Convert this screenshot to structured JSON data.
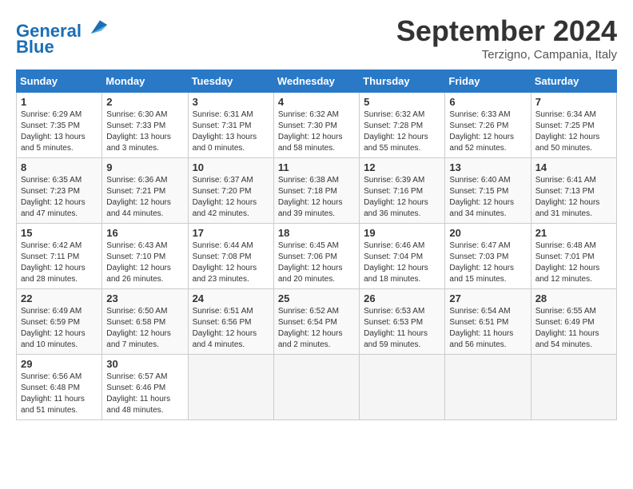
{
  "header": {
    "logo_line1": "General",
    "logo_line2": "Blue",
    "month_year": "September 2024",
    "location": "Terzigno, Campania, Italy"
  },
  "weekdays": [
    "Sunday",
    "Monday",
    "Tuesday",
    "Wednesday",
    "Thursday",
    "Friday",
    "Saturday"
  ],
  "weeks": [
    [
      {
        "day": "1",
        "info": "Sunrise: 6:29 AM\nSunset: 7:35 PM\nDaylight: 13 hours\nand 5 minutes."
      },
      {
        "day": "2",
        "info": "Sunrise: 6:30 AM\nSunset: 7:33 PM\nDaylight: 13 hours\nand 3 minutes."
      },
      {
        "day": "3",
        "info": "Sunrise: 6:31 AM\nSunset: 7:31 PM\nDaylight: 13 hours\nand 0 minutes."
      },
      {
        "day": "4",
        "info": "Sunrise: 6:32 AM\nSunset: 7:30 PM\nDaylight: 12 hours\nand 58 minutes."
      },
      {
        "day": "5",
        "info": "Sunrise: 6:32 AM\nSunset: 7:28 PM\nDaylight: 12 hours\nand 55 minutes."
      },
      {
        "day": "6",
        "info": "Sunrise: 6:33 AM\nSunset: 7:26 PM\nDaylight: 12 hours\nand 52 minutes."
      },
      {
        "day": "7",
        "info": "Sunrise: 6:34 AM\nSunset: 7:25 PM\nDaylight: 12 hours\nand 50 minutes."
      }
    ],
    [
      {
        "day": "8",
        "info": "Sunrise: 6:35 AM\nSunset: 7:23 PM\nDaylight: 12 hours\nand 47 minutes."
      },
      {
        "day": "9",
        "info": "Sunrise: 6:36 AM\nSunset: 7:21 PM\nDaylight: 12 hours\nand 44 minutes."
      },
      {
        "day": "10",
        "info": "Sunrise: 6:37 AM\nSunset: 7:20 PM\nDaylight: 12 hours\nand 42 minutes."
      },
      {
        "day": "11",
        "info": "Sunrise: 6:38 AM\nSunset: 7:18 PM\nDaylight: 12 hours\nand 39 minutes."
      },
      {
        "day": "12",
        "info": "Sunrise: 6:39 AM\nSunset: 7:16 PM\nDaylight: 12 hours\nand 36 minutes."
      },
      {
        "day": "13",
        "info": "Sunrise: 6:40 AM\nSunset: 7:15 PM\nDaylight: 12 hours\nand 34 minutes."
      },
      {
        "day": "14",
        "info": "Sunrise: 6:41 AM\nSunset: 7:13 PM\nDaylight: 12 hours\nand 31 minutes."
      }
    ],
    [
      {
        "day": "15",
        "info": "Sunrise: 6:42 AM\nSunset: 7:11 PM\nDaylight: 12 hours\nand 28 minutes."
      },
      {
        "day": "16",
        "info": "Sunrise: 6:43 AM\nSunset: 7:10 PM\nDaylight: 12 hours\nand 26 minutes."
      },
      {
        "day": "17",
        "info": "Sunrise: 6:44 AM\nSunset: 7:08 PM\nDaylight: 12 hours\nand 23 minutes."
      },
      {
        "day": "18",
        "info": "Sunrise: 6:45 AM\nSunset: 7:06 PM\nDaylight: 12 hours\nand 20 minutes."
      },
      {
        "day": "19",
        "info": "Sunrise: 6:46 AM\nSunset: 7:04 PM\nDaylight: 12 hours\nand 18 minutes."
      },
      {
        "day": "20",
        "info": "Sunrise: 6:47 AM\nSunset: 7:03 PM\nDaylight: 12 hours\nand 15 minutes."
      },
      {
        "day": "21",
        "info": "Sunrise: 6:48 AM\nSunset: 7:01 PM\nDaylight: 12 hours\nand 12 minutes."
      }
    ],
    [
      {
        "day": "22",
        "info": "Sunrise: 6:49 AM\nSunset: 6:59 PM\nDaylight: 12 hours\nand 10 minutes."
      },
      {
        "day": "23",
        "info": "Sunrise: 6:50 AM\nSunset: 6:58 PM\nDaylight: 12 hours\nand 7 minutes."
      },
      {
        "day": "24",
        "info": "Sunrise: 6:51 AM\nSunset: 6:56 PM\nDaylight: 12 hours\nand 4 minutes."
      },
      {
        "day": "25",
        "info": "Sunrise: 6:52 AM\nSunset: 6:54 PM\nDaylight: 12 hours\nand 2 minutes."
      },
      {
        "day": "26",
        "info": "Sunrise: 6:53 AM\nSunset: 6:53 PM\nDaylight: 11 hours\nand 59 minutes."
      },
      {
        "day": "27",
        "info": "Sunrise: 6:54 AM\nSunset: 6:51 PM\nDaylight: 11 hours\nand 56 minutes."
      },
      {
        "day": "28",
        "info": "Sunrise: 6:55 AM\nSunset: 6:49 PM\nDaylight: 11 hours\nand 54 minutes."
      }
    ],
    [
      {
        "day": "29",
        "info": "Sunrise: 6:56 AM\nSunset: 6:48 PM\nDaylight: 11 hours\nand 51 minutes."
      },
      {
        "day": "30",
        "info": "Sunrise: 6:57 AM\nSunset: 6:46 PM\nDaylight: 11 hours\nand 48 minutes."
      },
      {
        "day": "",
        "info": ""
      },
      {
        "day": "",
        "info": ""
      },
      {
        "day": "",
        "info": ""
      },
      {
        "day": "",
        "info": ""
      },
      {
        "day": "",
        "info": ""
      }
    ]
  ]
}
